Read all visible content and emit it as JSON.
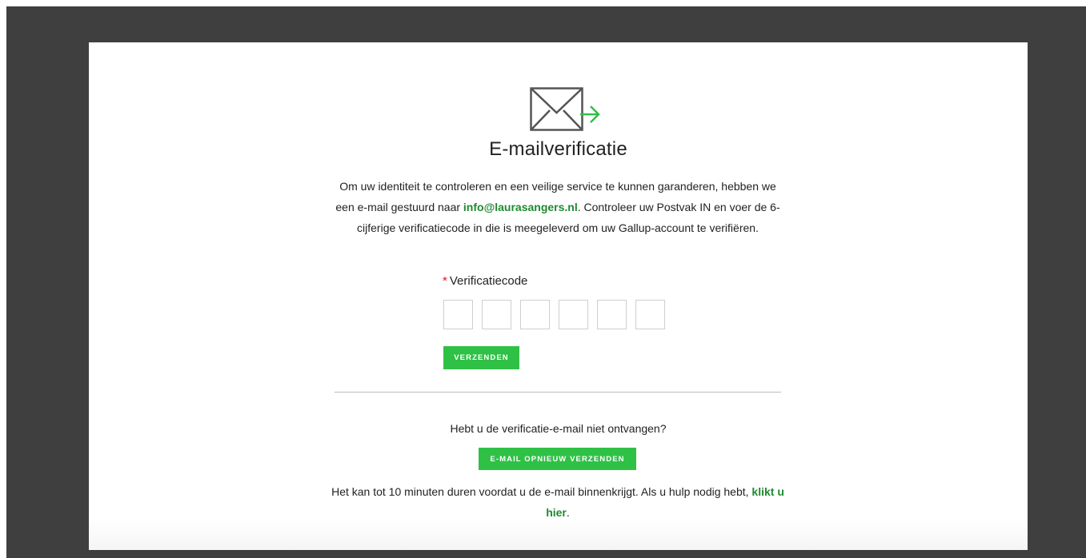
{
  "page": {
    "title": "E-mailverificatie",
    "description": {
      "before_email": "Om uw identiteit te controleren en een veilige service te kunnen garanderen, hebben we een e-mail gestuurd naar ",
      "email": "info@laurasangers.nl",
      "after_email": ". Controleer uw Postvak IN en voer de 6-cijferige verificatiecode in die is meegeleverd om uw Gallup-account te verifiëren."
    }
  },
  "form": {
    "required_mark": "*",
    "code_label": "Verificatiecode",
    "code_digits": [
      "",
      "",
      "",
      "",
      "",
      ""
    ],
    "submit_label": "VERZENDEN"
  },
  "resend": {
    "question": "Hebt u de verificatie-e-mail niet ontvangen?",
    "button_label": "E-MAIL OPNIEUW VERZENDEN",
    "help_text_before": "Het kan tot 10 minuten duren voordat u de e-mail binnenkrijgt. Als u hulp nodig hebt, ",
    "help_link": "klikt u hier",
    "help_text_after": "."
  },
  "colors": {
    "accent_green": "#2fc146",
    "link_green": "#1e8a2f",
    "required_red": "#e0161d",
    "backdrop": "#3f3f3f"
  },
  "icons": {
    "header": "envelope-send-icon"
  }
}
